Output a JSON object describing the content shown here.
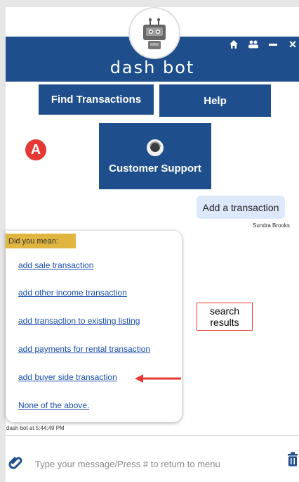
{
  "header": {
    "title": "dash bot",
    "icons": [
      "home-icon",
      "users-icon",
      "minimize-icon",
      "close-icon"
    ],
    "close_glyph": "×"
  },
  "menu": {
    "find_transactions": "Find Transactions",
    "help": "Help",
    "customer_support": "Customer Support"
  },
  "annotation_badge": "A",
  "user_message": {
    "text": "Add a transaction",
    "sender": "Sundra Brooks"
  },
  "bot_message": {
    "heading": "Did you mean:",
    "options": [
      "add sale transaction",
      "add other income transaction",
      "add transaction to existing listing",
      "add payments for rental transaction",
      "add buyer side transaction",
      "None of the above."
    ],
    "timestamp": "dash bot at 5:44:49 PM"
  },
  "callout": {
    "line1": "search",
    "line2": "results"
  },
  "composer": {
    "placeholder": "Type your message/Press # to return to menu"
  },
  "colors": {
    "brand": "#1f4e8c",
    "highlight": "#e0b641",
    "alert": "#e53935",
    "link": "#1a4fae",
    "user_bubble": "#dbe9fb"
  }
}
